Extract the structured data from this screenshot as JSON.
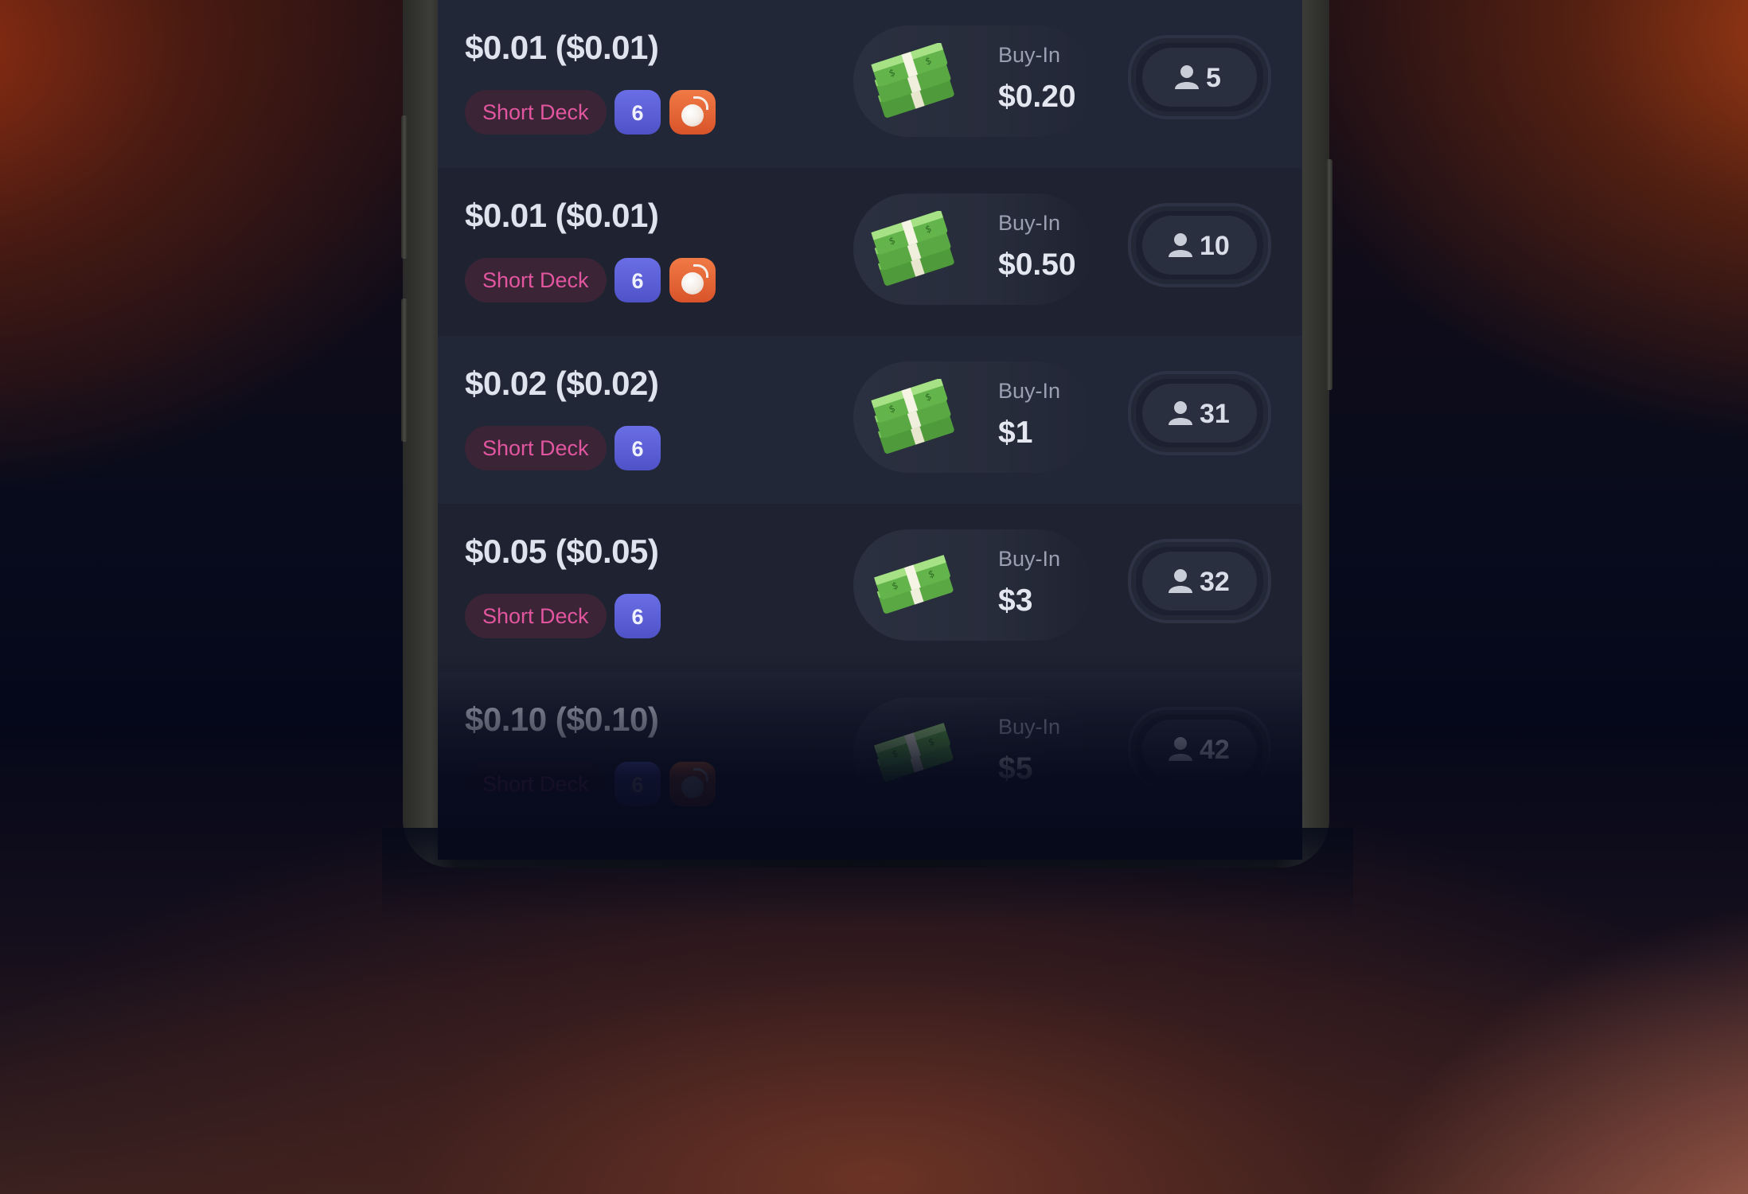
{
  "tables": [
    {
      "stakes": "$0.01 ($0.01)",
      "variant": "Short Deck",
      "seats": "6",
      "bomb_pot": true,
      "buyin_label": "Buy-In",
      "buyin_amount": "$0.20",
      "players": "5"
    },
    {
      "stakes": "$0.01 ($0.01)",
      "variant": "Short Deck",
      "seats": "6",
      "bomb_pot": true,
      "buyin_label": "Buy-In",
      "buyin_amount": "$0.50",
      "players": "10"
    },
    {
      "stakes": "$0.02 ($0.02)",
      "variant": "Short Deck",
      "seats": "6",
      "bomb_pot": false,
      "buyin_label": "Buy-In",
      "buyin_amount": "$1",
      "players": "31"
    },
    {
      "stakes": "$0.05 ($0.05)",
      "variant": "Short Deck",
      "seats": "6",
      "bomb_pot": false,
      "buyin_label": "Buy-In",
      "buyin_amount": "$3",
      "players": "32"
    },
    {
      "stakes": "$0.10 ($0.10)",
      "variant": "Short Deck",
      "seats": "6",
      "bomb_pot": true,
      "buyin_label": "Buy-In",
      "buyin_amount": "$5",
      "players": "42"
    }
  ],
  "icons": {
    "buyin": "money-stack-icon",
    "players": "user-icon",
    "bomb": "bomb-icon"
  },
  "colors": {
    "variant_text": "#e2569f",
    "seats_badge": "#5b5ed8",
    "bomb_badge": "#e4623a",
    "screen_bg": "#1f2331"
  }
}
